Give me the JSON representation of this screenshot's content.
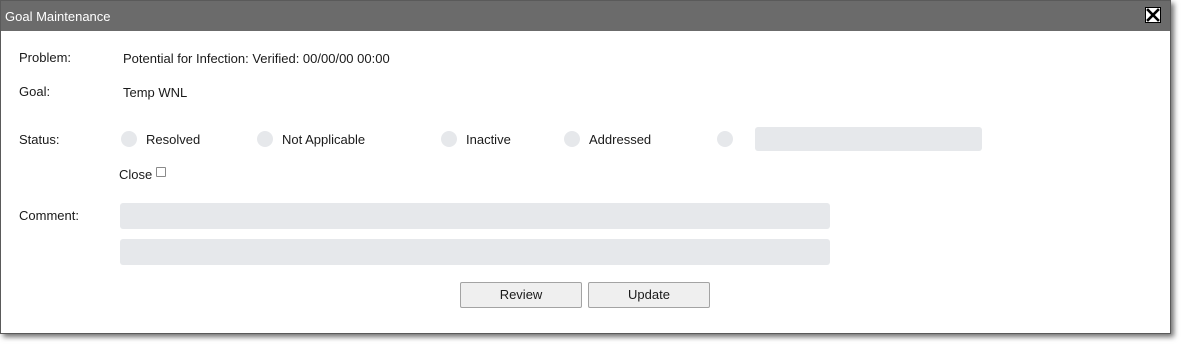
{
  "dialog": {
    "title": "Goal Maintenance",
    "close_icon": "close-x-icon"
  },
  "problem": {
    "label": "Problem:",
    "value": "Potential for Infection: Verified: 00/00/00 00:00"
  },
  "goal": {
    "label": "Goal:",
    "value": "Temp WNL"
  },
  "status": {
    "label": "Status:",
    "options": [
      "Resolved",
      "Not Applicable",
      "Inactive",
      "Addressed",
      ""
    ],
    "other_value": ""
  },
  "close": {
    "label": "Close",
    "checked": false
  },
  "comment": {
    "label": "Comment:",
    "line1": "",
    "line2": ""
  },
  "buttons": {
    "review": "Review",
    "update": "Update"
  },
  "colors": {
    "titlebar": "#6b6b6b",
    "field_bg": "#e6e8eb",
    "button_bg": "#efefef"
  }
}
